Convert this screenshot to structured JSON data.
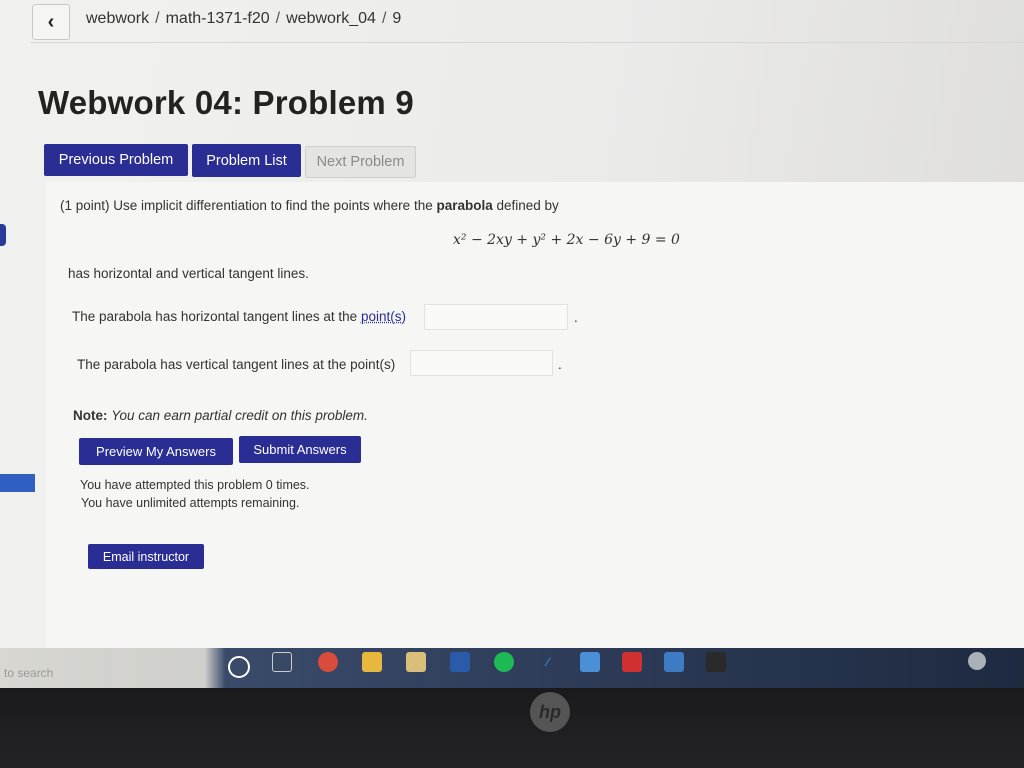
{
  "breadcrumb": {
    "back_icon": "chevron-left-icon",
    "items": [
      "webwork",
      "math-1371-f20",
      "webwork_04",
      "9"
    ],
    "separator": "/"
  },
  "page_title": "Webwork 04: Problem 9",
  "nav_buttons": {
    "previous": "Previous Problem",
    "list": "Problem List",
    "next": "Next Problem"
  },
  "problem": {
    "intro_points": "(1 point)",
    "intro_text": " Use implicit differentiation to find the points where the ",
    "intro_bold": "parabola",
    "intro_end": " defined by",
    "equation": "x² − 2xy + y² + 2x − 6y + 9 = 0",
    "after_equation": "has horizontal and vertical tangent lines.",
    "horizontal_prefix": "The parabola has horizontal tangent lines at the ",
    "horizontal_link": "point(s)",
    "horizontal_suffix": ".",
    "vertical_label": "The parabola has vertical tangent lines at the point(s)",
    "vertical_suffix": ".",
    "horizontal_answer": "",
    "vertical_answer": ""
  },
  "note": {
    "label": "Note:",
    "text": "You can earn partial credit on this problem."
  },
  "actions": {
    "preview": "Preview My Answers",
    "submit": "Submit Answers",
    "email": "Email instructor"
  },
  "attempts": {
    "line1": "You have attempted this problem 0 times.",
    "line2": "You have unlimited attempts remaining."
  },
  "taskbar": {
    "search_text": "to search"
  },
  "colors": {
    "button_primary": "#2a2d94",
    "link": "#2a2d94",
    "button_disabled": "#e4e4e3"
  }
}
